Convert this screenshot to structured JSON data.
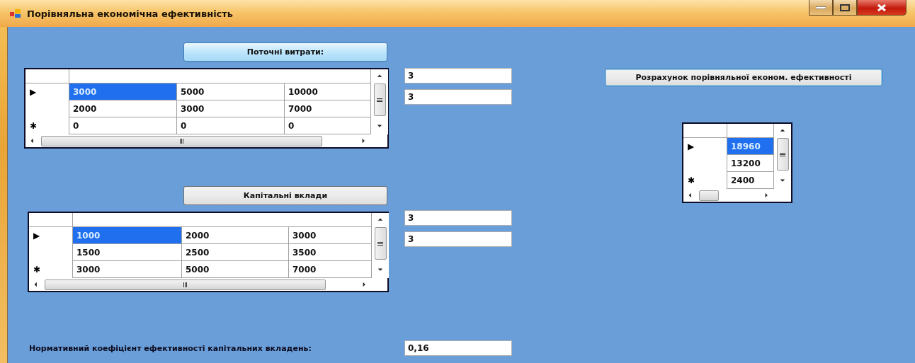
{
  "window": {
    "title": "Порівняльна економічна ефективність"
  },
  "current_costs": {
    "button": {
      "label": "Поточні витрати:",
      "highlighted": true
    },
    "grid": {
      "rows": [
        {
          "indicator": "▶",
          "cells": [
            {
              "text": "3000",
              "selected": true
            },
            {
              "text": "5000",
              "selected": false
            },
            {
              "text": "10000",
              "selected": false
            }
          ]
        },
        {
          "cells": [
            {
              "text": "2000",
              "selected": false
            },
            {
              "text": "3000",
              "selected": false
            },
            {
              "text": "7000",
              "selected": false
            }
          ]
        },
        {
          "indicator": "✱",
          "cells": [
            {
              "text": "0",
              "selected": false
            },
            {
              "text": "0",
              "selected": false
            },
            {
              "text": "0",
              "selected": false
            }
          ]
        }
      ]
    },
    "fields": [
      "3",
      "3"
    ]
  },
  "capital_investments": {
    "button": {
      "label": "Капітальні вклади",
      "highlighted": false
    },
    "grid": {
      "rows": [
        {
          "indicator": "▶",
          "cells": [
            {
              "text": "1000",
              "selected": true
            },
            {
              "text": "2000",
              "selected": false
            },
            {
              "text": "3000",
              "selected": false
            }
          ]
        },
        {
          "cells": [
            {
              "text": "1500",
              "selected": false
            },
            {
              "text": "2500",
              "selected": false
            },
            {
              "text": "3500",
              "selected": false
            }
          ]
        },
        {
          "indicator": "✱",
          "cells": [
            {
              "text": "3000",
              "selected": false
            },
            {
              "text": "5000",
              "selected": false
            },
            {
              "text": "7000",
              "selected": false
            }
          ]
        }
      ]
    },
    "fields": [
      "3",
      "3"
    ]
  },
  "calculate_button": {
    "label": "Розрахунок порівняльної економ. ефективності",
    "highlighted": false
  },
  "result_grid": {
    "rows": [
      {
        "indicator": "▶",
        "cells": [
          {
            "text": "18960",
            "selected": true
          }
        ]
      },
      {
        "cells": [
          {
            "text": "13200",
            "selected": false
          }
        ]
      },
      {
        "indicator": "✱",
        "cells": [
          {
            "text": "2400",
            "selected": false
          }
        ]
      }
    ]
  },
  "coefficient": {
    "label": "Нормативний коефіцієнт ефективності капітальних вкладень:",
    "value": "0,16"
  }
}
